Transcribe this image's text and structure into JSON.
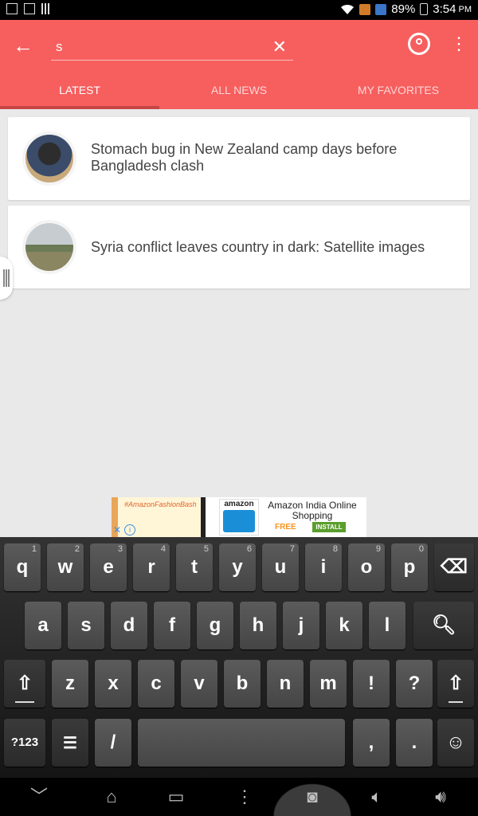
{
  "status_bar": {
    "battery": "89%",
    "time": "3:54",
    "ampm": "PM"
  },
  "app_bar": {
    "search_value": "s",
    "tabs": [
      {
        "label": "LATEST",
        "active": true
      },
      {
        "label": "ALL NEWS",
        "active": false
      },
      {
        "label": "MY FAVORITES",
        "active": false
      }
    ]
  },
  "news": [
    {
      "headline": "Stomach bug in New Zealand camp days before Bangladesh clash"
    },
    {
      "headline": "Syria conflict leaves country in dark: Satellite images"
    }
  ],
  "ad": {
    "banner_text": "#AmazonFashionBash",
    "brand": "amazon",
    "title": "Amazon India Online Shopping",
    "price": "FREE",
    "cta": "INSTALL"
  },
  "keyboard": {
    "row1": [
      {
        "label": "q",
        "hint": "1"
      },
      {
        "label": "w",
        "hint": "2"
      },
      {
        "label": "e",
        "hint": "3"
      },
      {
        "label": "r",
        "hint": "4"
      },
      {
        "label": "t",
        "hint": "5"
      },
      {
        "label": "y",
        "hint": "6"
      },
      {
        "label": "u",
        "hint": "7"
      },
      {
        "label": "i",
        "hint": "8"
      },
      {
        "label": "o",
        "hint": "9"
      },
      {
        "label": "p",
        "hint": "0"
      }
    ],
    "row2": [
      "a",
      "s",
      "d",
      "f",
      "g",
      "h",
      "j",
      "k",
      "l"
    ],
    "row3": [
      "z",
      "x",
      "c",
      "v",
      "b",
      "n",
      "m",
      "!",
      "?"
    ],
    "row4": {
      "mode_key": "?123",
      "slash": "/",
      "comma": ",",
      "period": "."
    }
  }
}
